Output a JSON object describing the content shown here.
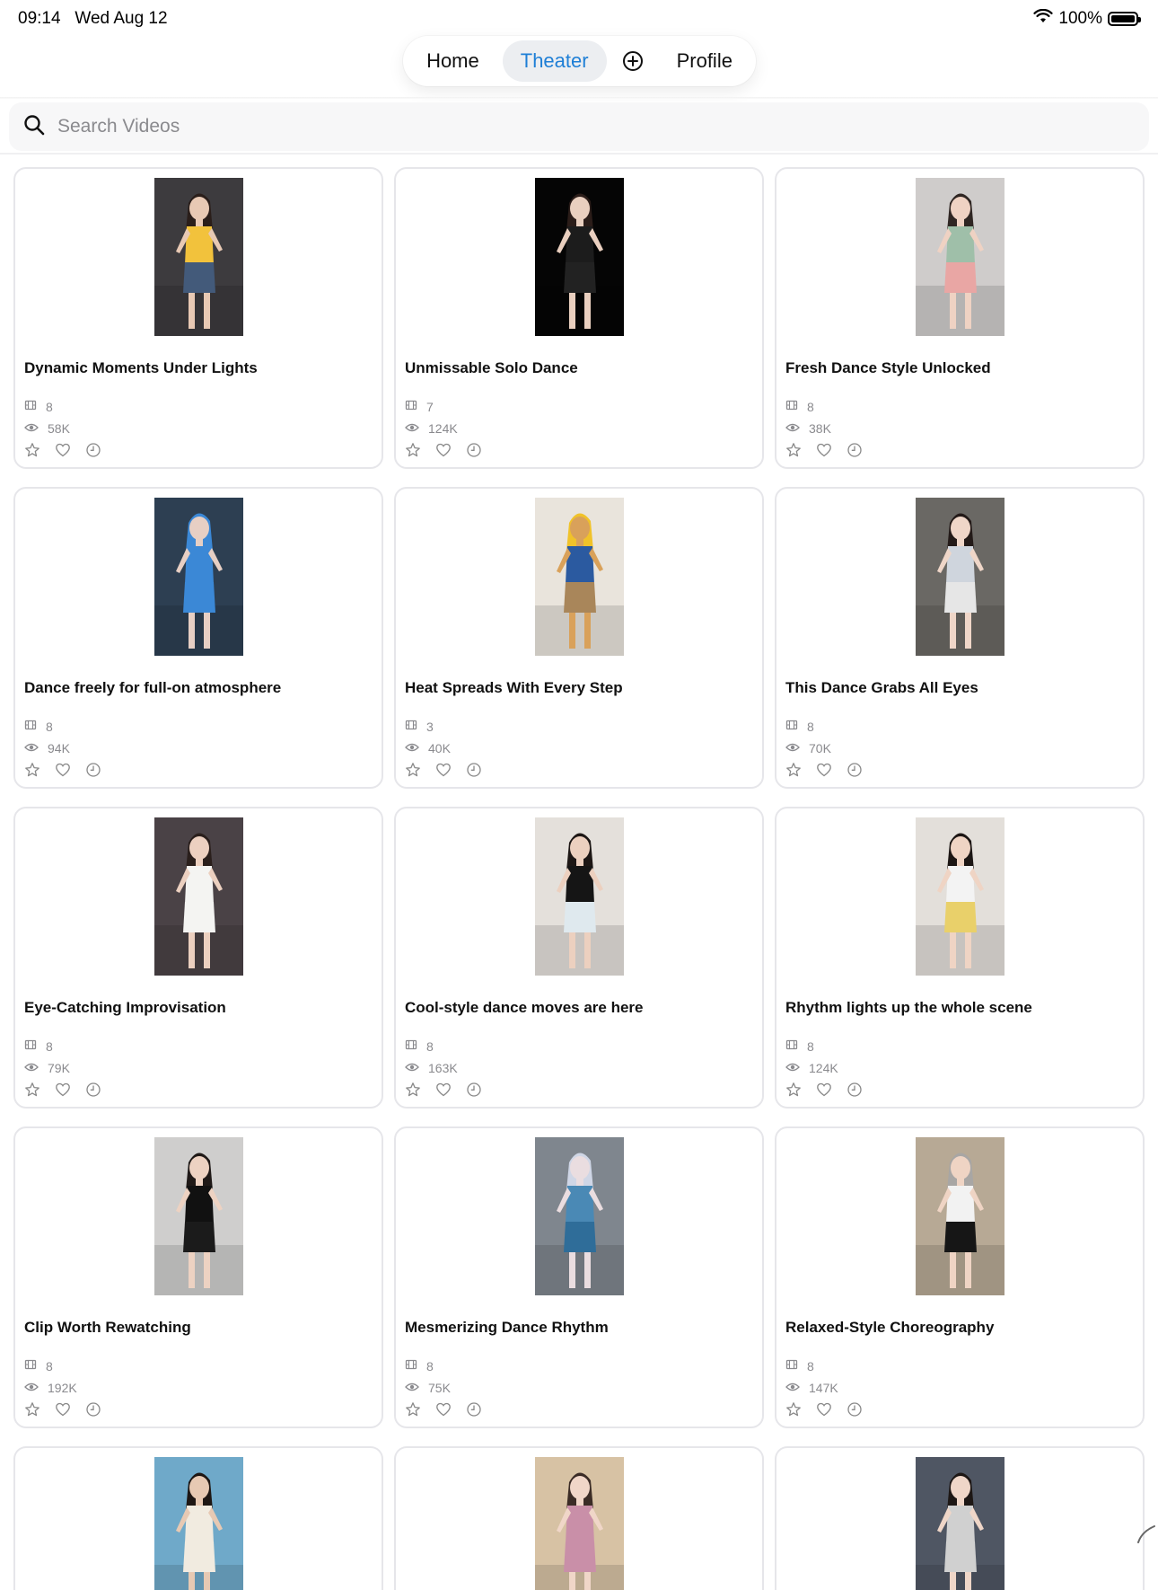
{
  "status": {
    "time": "09:14",
    "date": "Wed Aug 12",
    "battery": "100%"
  },
  "nav": {
    "home": "Home",
    "theater": "Theater",
    "profile": "Profile"
  },
  "search": {
    "placeholder": "Search Videos"
  },
  "videos": [
    {
      "title": "Dynamic Moments Under Lights",
      "episodes": "8",
      "views": "58K",
      "thumb": {
        "bg": "#3d3b3e",
        "skin": "#e8c9b4",
        "hair": "#2a1e1a",
        "top": "#f2c23c",
        "bottom": "#435a7a"
      }
    },
    {
      "title": "Unmissable Solo Dance",
      "episodes": "7",
      "views": "124K",
      "thumb": {
        "bg": "#050505",
        "skin": "#e9cfbf",
        "hair": "#2b1d19",
        "top": "#1c1c1c",
        "bottom": "#222222"
      }
    },
    {
      "title": "Fresh Dance Style Unlocked",
      "episodes": "8",
      "views": "38K",
      "thumb": {
        "bg": "#cfcccb",
        "skin": "#efd2c3",
        "hair": "#2f2623",
        "top": "#9fbfa9",
        "bottom": "#e9a6a4"
      }
    },
    {
      "title": "Dance freely for full-on atmosphere",
      "episodes": "8",
      "views": "94K",
      "thumb": {
        "bg": "#2d3f52",
        "skin": "#e7cfc4",
        "hair": "#3b88d6",
        "top": "#3b88d6",
        "bottom": "#3b88d6"
      }
    },
    {
      "title": "Heat Spreads With Every Step",
      "episodes": "3",
      "views": "40K",
      "thumb": {
        "bg": "#e9e4dc",
        "skin": "#d9a15a",
        "hair": "#f0c22a",
        "top": "#2b5aa0",
        "bottom": "#a9865a"
      }
    },
    {
      "title": "This Dance Grabs All Eyes",
      "episodes": "8",
      "views": "70K",
      "thumb": {
        "bg": "#6a6864",
        "skin": "#efd6c8",
        "hair": "#231a18",
        "top": "#cfd5dd",
        "bottom": "#e6e6e6"
      }
    },
    {
      "title": "Eye-Catching Improvisation",
      "episodes": "8",
      "views": "79K",
      "thumb": {
        "bg": "#4a4246",
        "skin": "#ecd0c0",
        "hair": "#2a1f1c",
        "top": "#f4f4f2",
        "bottom": "#f4f4f2"
      }
    },
    {
      "title": "Cool-style dance moves are here",
      "episodes": "8",
      "views": "163K",
      "thumb": {
        "bg": "#e4e0db",
        "skin": "#ecd0bf",
        "hair": "#1d1715",
        "top": "#151515",
        "bottom": "#dfe9ee"
      }
    },
    {
      "title": "Rhythm lights up the whole scene",
      "episodes": "8",
      "views": "124K",
      "thumb": {
        "bg": "#e3dfda",
        "skin": "#efd4c4",
        "hair": "#1c1614",
        "top": "#f3f3f3",
        "bottom": "#e9d06a"
      }
    },
    {
      "title": "Clip Worth Rewatching",
      "episodes": "8",
      "views": "192K",
      "thumb": {
        "bg": "#cfcecd",
        "skin": "#edd2c2",
        "hair": "#1f1917",
        "top": "#111111",
        "bottom": "#1b1b1b"
      }
    },
    {
      "title": "Mesmerizing Dance Rhythm",
      "episodes": "8",
      "views": "75K",
      "thumb": {
        "bg": "#7f868e",
        "skin": "#eadde0",
        "hair": "#cfd6e6",
        "top": "#4a89b5",
        "bottom": "#2f6d99"
      }
    },
    {
      "title": "Relaxed-Style Choreography",
      "episodes": "8",
      "views": "147K",
      "thumb": {
        "bg": "#b7a995",
        "skin": "#efd4c4",
        "hair": "#a8a6a4",
        "top": "#f2f2f2",
        "bottom": "#161616"
      }
    }
  ],
  "partial_thumbs": [
    {
      "bg": "#6fa9c9",
      "skin": "#e7c9b3",
      "hair": "#1e1714",
      "top": "#f1ebe0"
    },
    {
      "bg": "#d7c2a4",
      "skin": "#f0d6c8",
      "hair": "#3b2c26",
      "top": "#c98fa8"
    },
    {
      "bg": "#4f5663",
      "skin": "#efd6c8",
      "hair": "#1d1715",
      "top": "#d0d0d0"
    }
  ]
}
